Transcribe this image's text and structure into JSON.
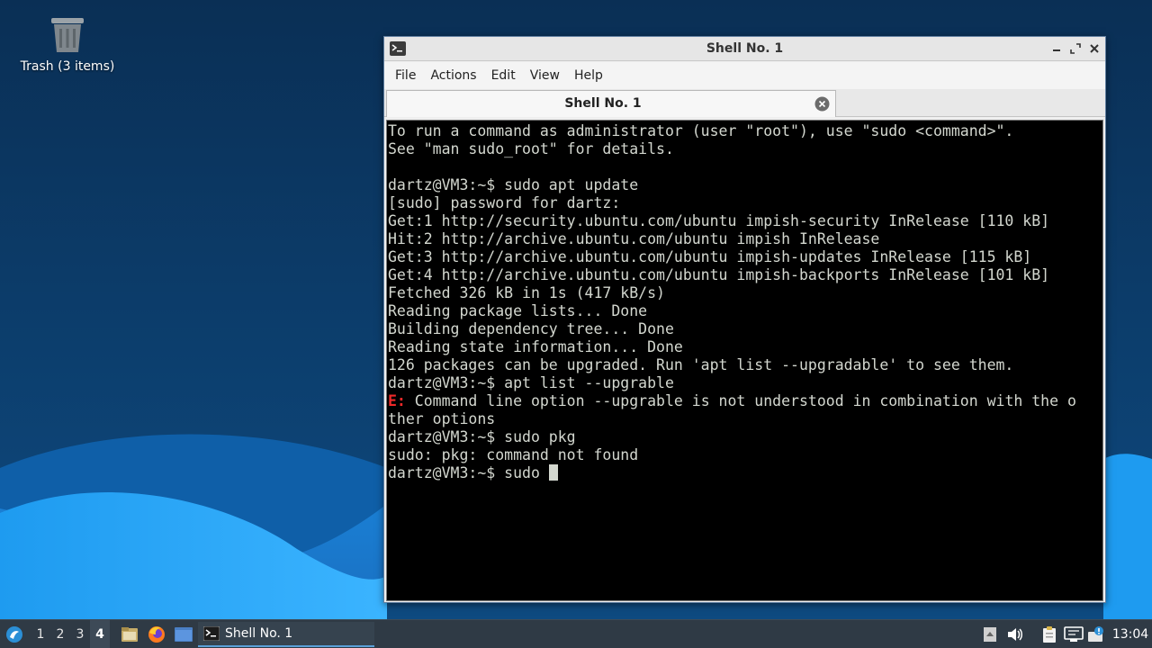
{
  "desktop": {
    "trash_label": "Trash (3 items)"
  },
  "window": {
    "title": "Shell No. 1",
    "menu": [
      "File",
      "Actions",
      "Edit",
      "View",
      "Help"
    ],
    "tab_label": "Shell No. 1"
  },
  "terminal": {
    "lines": [
      "To run a command as administrator (user \"root\"), use \"sudo <command>\".",
      "See \"man sudo_root\" for details.",
      "",
      "dartz@VM3:~$ sudo apt update",
      "[sudo] password for dartz:",
      "Get:1 http://security.ubuntu.com/ubuntu impish-security InRelease [110 kB]",
      "Hit:2 http://archive.ubuntu.com/ubuntu impish InRelease",
      "Get:3 http://archive.ubuntu.com/ubuntu impish-updates InRelease [115 kB]",
      "Get:4 http://archive.ubuntu.com/ubuntu impish-backports InRelease [101 kB]",
      "Fetched 326 kB in 1s (417 kB/s)",
      "Reading package lists... Done",
      "Building dependency tree... Done",
      "Reading state information... Done",
      "126 packages can be upgraded. Run 'apt list --upgradable' to see them.",
      "dartz@VM3:~$ apt list --upgrable"
    ],
    "error_prefix": "E:",
    "error_line_1": " Command line option --upgrable is not understood in combination with the o",
    "error_line_2": "ther options",
    "after_lines": [
      "dartz@VM3:~$ sudo pkg",
      "sudo: pkg: command not found"
    ],
    "prompt_line": "dartz@VM3:~$ sudo "
  },
  "taskbar": {
    "workspaces": [
      "1",
      "2",
      "3",
      "4"
    ],
    "active_workspace": "4",
    "task_label": "Shell No. 1",
    "clock": "13:04"
  },
  "colors": {
    "terminal_bg": "#000000",
    "terminal_fg": "#d3d7cf",
    "error": "#ef2929",
    "taskbar_bg": "#2f3a45",
    "desktop_dark": "#0a3a66",
    "desktop_wave": "#1e9bf0"
  },
  "icons": {
    "menu_start": "lubuntu-logo-icon",
    "file_manager": "file-manager-icon",
    "browser": "firefox-icon",
    "show_desktop": "show-desktop-icon",
    "terminal": "terminal-icon",
    "volume": "volume-icon",
    "clipboard": "clipboard-icon",
    "network": "network-icon",
    "updates": "update-notifier-icon",
    "trash": "trash-icon"
  }
}
